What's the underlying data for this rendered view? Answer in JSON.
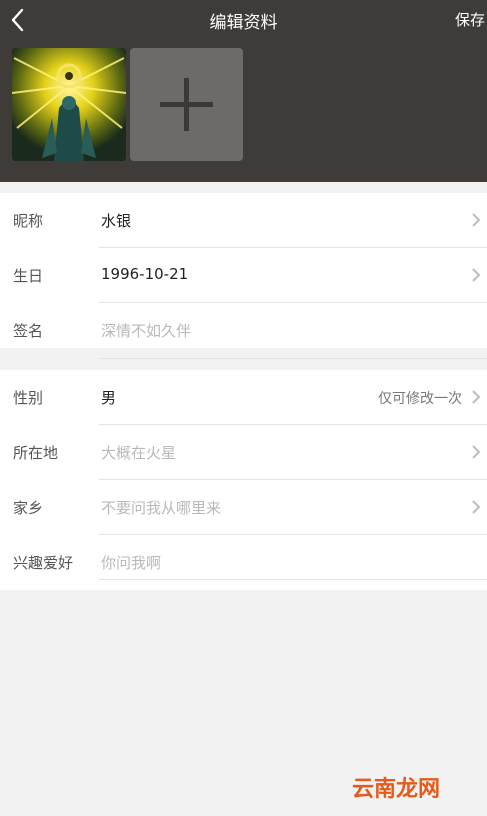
{
  "topbar": {
    "title": "编辑资料",
    "save_label": "保存"
  },
  "photos": {
    "avatar_alt": "avatar-image",
    "add_icon": "plus-icon"
  },
  "section1": {
    "rows": [
      {
        "label": "昵称",
        "value": "水银"
      },
      {
        "label": "生日",
        "value": "1996-10-21"
      },
      {
        "label": "签名",
        "placeholder": "深情不如久伴"
      }
    ]
  },
  "section2": {
    "rows": [
      {
        "label": "性别",
        "value": "男",
        "hint": "仅可修改一次"
      },
      {
        "label": "所在地",
        "placeholder": "大概在火星"
      },
      {
        "label": "家乡",
        "placeholder": "不要问我从哪里来"
      },
      {
        "label": "兴趣爱好",
        "placeholder": "你问我啊"
      }
    ]
  },
  "watermark": "云南龙网",
  "colors": {
    "header_bg": "#3e3b39",
    "page_bg": "#f2f2f2",
    "watermark": "#e85a1a"
  }
}
